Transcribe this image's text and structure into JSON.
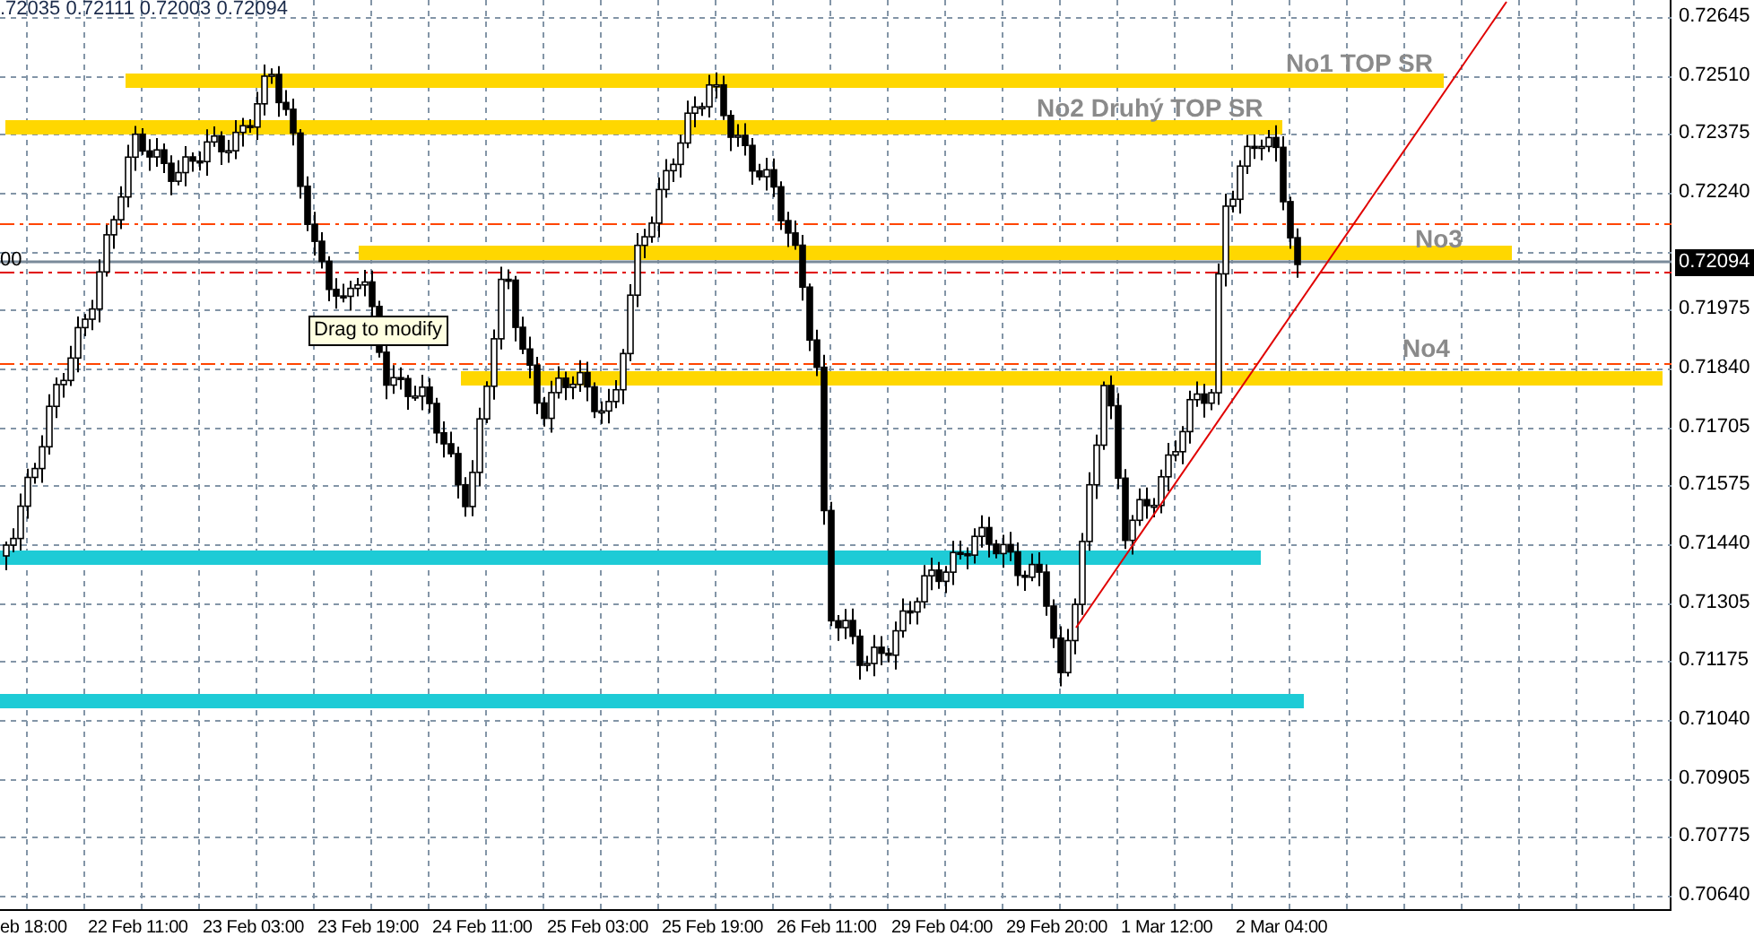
{
  "header": {
    "ohlc": ".72035 0.72111 0.72003 0.72094"
  },
  "left_price_label": "00",
  "tooltip": "Drag to modify",
  "levels": [
    {
      "label": "No1 TOP SR",
      "color": "#ffd700"
    },
    {
      "label": "No2 Druhý TOP SR",
      "color": "#ffd700"
    },
    {
      "label": "No3",
      "color": "#ffd700"
    },
    {
      "label": "No4",
      "color": "#ffd700"
    },
    {
      "color": "#1ecbd6"
    },
    {
      "color": "#1ecbd6"
    }
  ],
  "price_axis": {
    "ticks": [
      "0.72645",
      "0.72510",
      "0.72375",
      "0.72240",
      "0.71975",
      "0.71840",
      "0.71705",
      "0.71575",
      "0.71440",
      "0.71305",
      "0.71175",
      "0.71040",
      "0.70905",
      "0.70775",
      "0.70640"
    ],
    "current_price": "0.72094"
  },
  "time_axis": {
    "labels": [
      "eb 18:00",
      "22 Feb 11:00",
      "23 Feb 03:00",
      "23 Feb 19:00",
      "24 Feb 11:00",
      "25 Feb 03:00",
      "25 Feb 19:00",
      "26 Feb 11:00",
      "29 Feb 04:00",
      "29 Feb 20:00",
      "1 Mar 12:00",
      "2 Mar 04:00"
    ]
  }
}
